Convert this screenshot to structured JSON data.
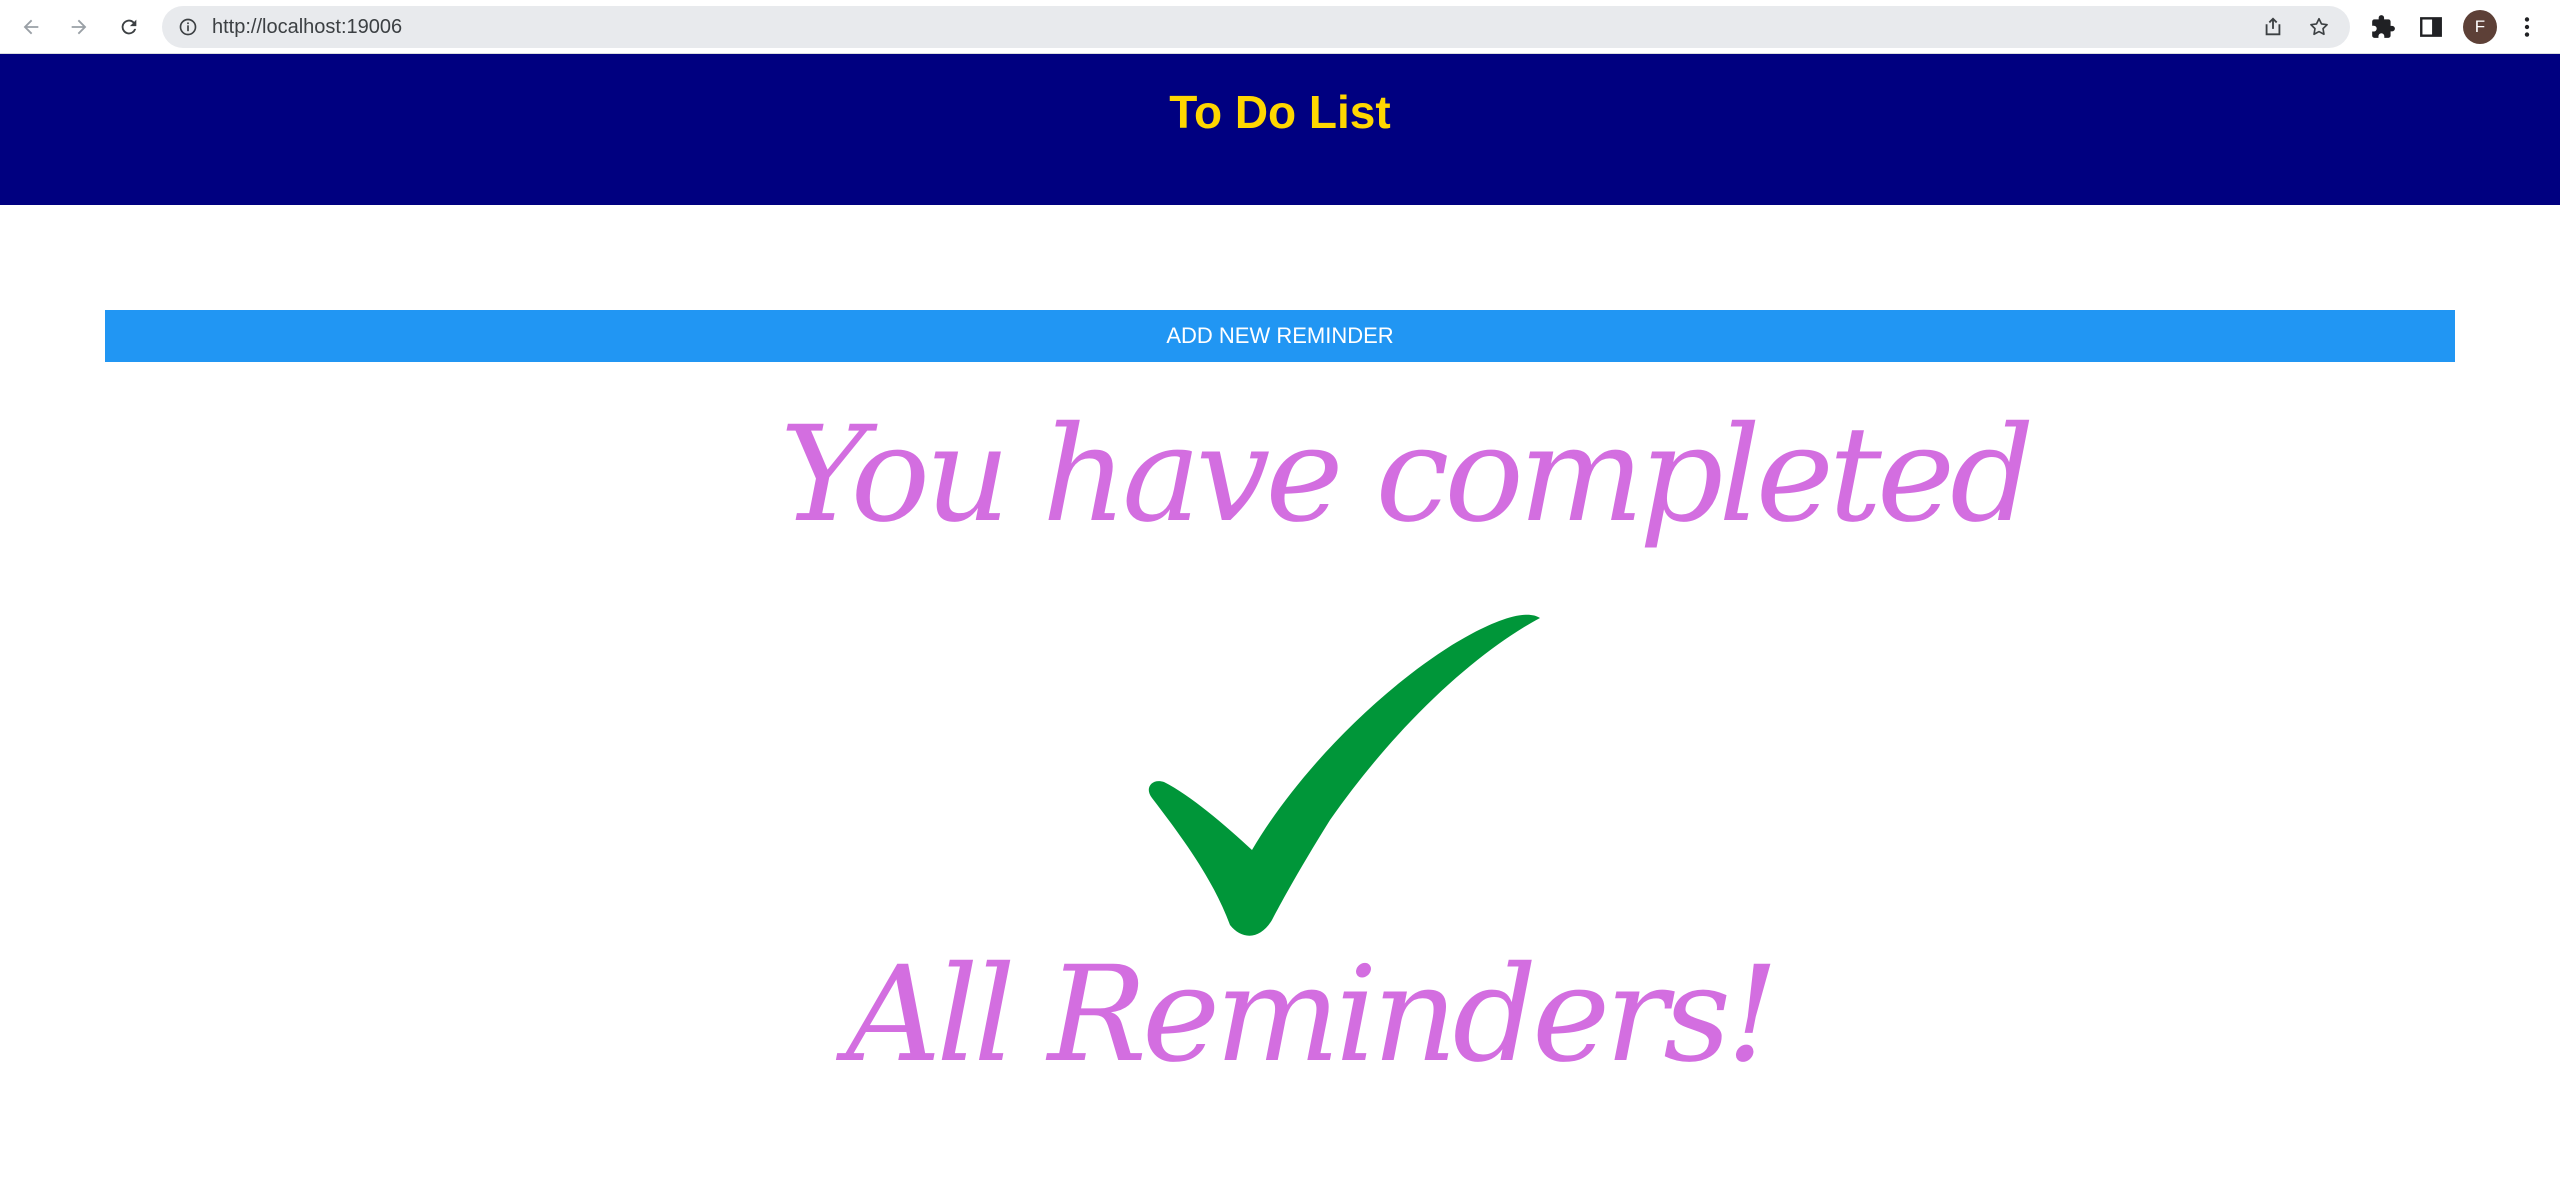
{
  "browser": {
    "url": "http://localhost:19006",
    "profile_initial": "F"
  },
  "header": {
    "title": "To Do List"
  },
  "actions": {
    "add_label": "ADD NEW REMINDER"
  },
  "empty_state": {
    "line1": "You have completed",
    "line2": "All Reminders!"
  },
  "colors": {
    "header_bg": "#000080",
    "title_color": "#ffd700",
    "button_bg": "#2196f3",
    "message_color": "#d36ee0",
    "checkmark_color": "#009639"
  }
}
